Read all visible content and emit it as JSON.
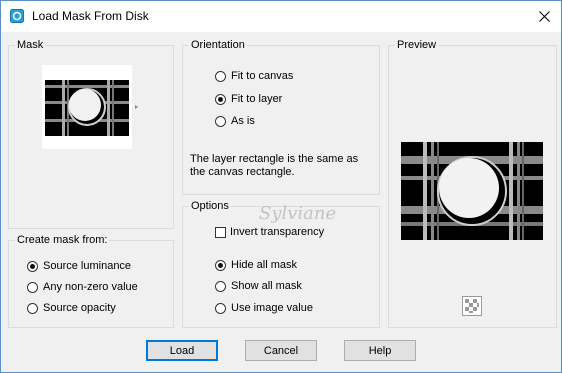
{
  "window": {
    "title": "Load Mask From Disk"
  },
  "mask_group": {
    "label": "Mask"
  },
  "create_mask_group": {
    "label": "Create mask from:",
    "options": [
      {
        "label": "Source luminance",
        "selected": true
      },
      {
        "label": "Any non-zero value",
        "selected": false
      },
      {
        "label": "Source opacity",
        "selected": false
      }
    ]
  },
  "orientation_group": {
    "label": "Orientation",
    "options": [
      {
        "label": "Fit to canvas",
        "selected": false
      },
      {
        "label": "Fit to layer",
        "selected": true
      },
      {
        "label": "As is",
        "selected": false
      }
    ],
    "info_line1": "The layer rectangle is the same as",
    "info_line2": "the canvas rectangle."
  },
  "options_group": {
    "label": "Options",
    "invert_label": "Invert transparency",
    "invert_checked": false,
    "options": [
      {
        "label": "Hide all mask",
        "selected": true
      },
      {
        "label": "Show all mask",
        "selected": false
      },
      {
        "label": "Use image value",
        "selected": false
      }
    ]
  },
  "preview_group": {
    "label": "Preview"
  },
  "buttons": {
    "load": "Load",
    "cancel": "Cancel",
    "help": "Help"
  },
  "watermark": "Sylviane"
}
